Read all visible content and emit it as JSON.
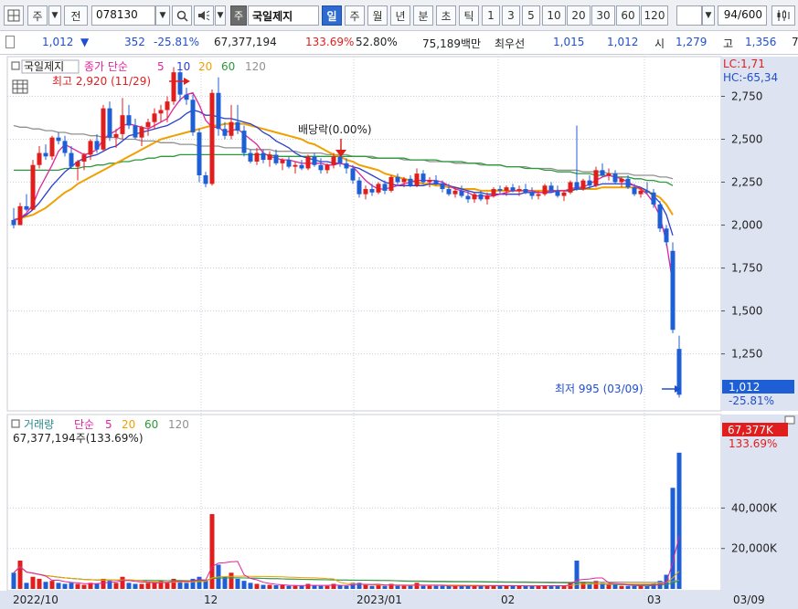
{
  "toolbar": {
    "market_type": "주",
    "code_prefix": "전",
    "stock_code": "078130",
    "stock_badge": "주",
    "stock_name": "국일제지",
    "periods": [
      "일",
      "주",
      "월",
      "년",
      "분",
      "초",
      "틱"
    ],
    "active_period": "일",
    "intervals": [
      "1",
      "3",
      "5",
      "10",
      "20",
      "30",
      "60",
      "120"
    ],
    "page_counter": "94",
    "page_total": "/600"
  },
  "quote": {
    "price": "1,012",
    "change_arrow": "▼",
    "change": "352",
    "change_pct": "-25.81%",
    "volume": "67,377,194",
    "volume_ratio": "133.69%",
    "turnover_ratio": "52.80%",
    "trade_value": "75,189백만",
    "best_label": "최우선",
    "best_ask": "1,015",
    "best_bid": "1,012",
    "open_label": "시",
    "open": "1,279",
    "high_label": "고",
    "high": "1,356",
    "trailing": "7"
  },
  "price_panel": {
    "title": "국일제지",
    "ma_label": "종가 단순",
    "ma_periods": [
      "5",
      "10",
      "20",
      "60",
      "120"
    ],
    "ma_colors": {
      "5": "#e0249a",
      "10": "#2a3fd0",
      "20": "#f0a000",
      "60": "#2a9a3a",
      "120": "#909090"
    },
    "lc": "LC:1,71",
    "hc": "HC:-65,34",
    "high_marker": "최고 2,920 (11/29)",
    "low_marker": "최저 995 (03/09)",
    "dividend_marker": "배당락(0.00%)",
    "last_price": "1,012",
    "last_change_pct": "-25.81%",
    "y_ticks": [
      "2,750",
      "2,500",
      "2,250",
      "2,000",
      "1,750",
      "1,500",
      "1,250"
    ]
  },
  "volume_panel": {
    "title": "거래량",
    "ma_label": "단순",
    "ma_periods": [
      "5",
      "20",
      "60",
      "120"
    ],
    "info": "67,377,194주(133.69%)",
    "last_volume": "67,377K",
    "last_ratio": "133.69%",
    "y_ticks": [
      "40,000K",
      "20,000K"
    ]
  },
  "x_axis": {
    "labels": [
      "2022/10",
      "12",
      "2023/01",
      "02",
      "03",
      "03/09"
    ]
  },
  "colors": {
    "up": "#e01e1e",
    "down": "#1f5fd6",
    "axis_bg": "#dde3f0",
    "accent": "#2d6bd0"
  },
  "chart_data": {
    "type": "candlestick",
    "price_range": [
      950,
      2960
    ],
    "volume_range": [
      0,
      70000
    ],
    "candles": [
      [
        2030,
        2100,
        1980,
        2000,
        8000
      ],
      [
        2000,
        2130,
        2000,
        2110,
        14000
      ],
      [
        2110,
        2180,
        2080,
        2090,
        3000
      ],
      [
        2090,
        2380,
        2090,
        2350,
        6000
      ],
      [
        2350,
        2460,
        2330,
        2420,
        5000
      ],
      [
        2420,
        2470,
        2380,
        2400,
        3500
      ],
      [
        2400,
        2520,
        2380,
        2510,
        4000
      ],
      [
        2510,
        2540,
        2470,
        2490,
        3000
      ],
      [
        2490,
        2520,
        2400,
        2420,
        2500
      ],
      [
        2420,
        2460,
        2330,
        2340,
        3000
      ],
      [
        2340,
        2380,
        2260,
        2370,
        2500
      ],
      [
        2370,
        2420,
        2320,
        2410,
        2000
      ],
      [
        2410,
        2500,
        2380,
        2490,
        3000
      ],
      [
        2490,
        2530,
        2420,
        2440,
        2500
      ],
      [
        2440,
        2700,
        2430,
        2680,
        5000
      ],
      [
        2680,
        2720,
        2490,
        2510,
        4000
      ],
      [
        2510,
        2560,
        2450,
        2530,
        3000
      ],
      [
        2530,
        2740,
        2500,
        2640,
        6000
      ],
      [
        2640,
        2700,
        2560,
        2580,
        3000
      ],
      [
        2580,
        2620,
        2500,
        2510,
        2500
      ],
      [
        2510,
        2580,
        2460,
        2570,
        2500
      ],
      [
        2570,
        2620,
        2520,
        2600,
        3000
      ],
      [
        2600,
        2680,
        2560,
        2650,
        3500
      ],
      [
        2650,
        2700,
        2600,
        2670,
        4000
      ],
      [
        2670,
        2750,
        2600,
        2720,
        3000
      ],
      [
        2720,
        2920,
        2700,
        2890,
        5000
      ],
      [
        2890,
        2900,
        2720,
        2760,
        4000
      ],
      [
        2760,
        2800,
        2700,
        2730,
        3000
      ],
      [
        2730,
        2760,
        2520,
        2540,
        5000
      ],
      [
        2540,
        2560,
        2250,
        2290,
        6000
      ],
      [
        2290,
        2310,
        2220,
        2240,
        4000
      ],
      [
        2240,
        2790,
        2230,
        2770,
        37000
      ],
      [
        2770,
        2860,
        2520,
        2560,
        12000
      ],
      [
        2560,
        2600,
        2500,
        2520,
        6000
      ],
      [
        2520,
        2700,
        2500,
        2600,
        8000
      ],
      [
        2600,
        2700,
        2530,
        2550,
        5000
      ],
      [
        2550,
        2580,
        2400,
        2420,
        4000
      ],
      [
        2420,
        2440,
        2360,
        2370,
        3000
      ],
      [
        2370,
        2450,
        2350,
        2420,
        2500
      ],
      [
        2420,
        2440,
        2360,
        2380,
        2000
      ],
      [
        2380,
        2430,
        2340,
        2410,
        2000
      ],
      [
        2410,
        2440,
        2350,
        2360,
        1800
      ],
      [
        2360,
        2390,
        2320,
        2380,
        1800
      ],
      [
        2380,
        2400,
        2330,
        2340,
        1500
      ],
      [
        2340,
        2370,
        2300,
        2350,
        1500
      ],
      [
        2350,
        2380,
        2320,
        2330,
        1500
      ],
      [
        2330,
        2410,
        2320,
        2400,
        2500
      ],
      [
        2400,
        2420,
        2340,
        2350,
        1800
      ],
      [
        2350,
        2390,
        2300,
        2320,
        1500
      ],
      [
        2320,
        2360,
        2300,
        2350,
        1500
      ],
      [
        2350,
        2420,
        2330,
        2400,
        2500
      ],
      [
        2400,
        2410,
        2340,
        2360,
        1800
      ],
      [
        2360,
        2390,
        2300,
        2330,
        1500
      ],
      [
        2330,
        2350,
        2240,
        2260,
        3000
      ],
      [
        2260,
        2280,
        2160,
        2180,
        3000
      ],
      [
        2180,
        2230,
        2150,
        2210,
        2000
      ],
      [
        2210,
        2240,
        2170,
        2190,
        1500
      ],
      [
        2190,
        2250,
        2180,
        2240,
        2000
      ],
      [
        2240,
        2260,
        2180,
        2200,
        1500
      ],
      [
        2200,
        2290,
        2190,
        2280,
        2500
      ],
      [
        2280,
        2300,
        2230,
        2250,
        1500
      ],
      [
        2250,
        2280,
        2220,
        2270,
        1500
      ],
      [
        2270,
        2290,
        2220,
        2230,
        1500
      ],
      [
        2230,
        2330,
        2220,
        2300,
        3000
      ],
      [
        2300,
        2320,
        2240,
        2250,
        1500
      ],
      [
        2250,
        2280,
        2220,
        2260,
        1500
      ],
      [
        2260,
        2290,
        2230,
        2240,
        1500
      ],
      [
        2240,
        2260,
        2190,
        2210,
        1500
      ],
      [
        2210,
        2240,
        2170,
        2180,
        1500
      ],
      [
        2180,
        2220,
        2160,
        2200,
        1500
      ],
      [
        2200,
        2230,
        2160,
        2170,
        1500
      ],
      [
        2170,
        2200,
        2130,
        2150,
        1500
      ],
      [
        2150,
        2190,
        2130,
        2180,
        1500
      ],
      [
        2180,
        2200,
        2140,
        2150,
        1500
      ],
      [
        2150,
        2190,
        2120,
        2170,
        1500
      ],
      [
        2170,
        2220,
        2160,
        2210,
        1800
      ],
      [
        2210,
        2230,
        2180,
        2200,
        1500
      ],
      [
        2200,
        2230,
        2170,
        2220,
        1500
      ],
      [
        2220,
        2240,
        2190,
        2200,
        1500
      ],
      [
        2200,
        2230,
        2170,
        2210,
        1500
      ],
      [
        2210,
        2240,
        2180,
        2190,
        1500
      ],
      [
        2190,
        2220,
        2150,
        2170,
        1500
      ],
      [
        2170,
        2200,
        2150,
        2180,
        1500
      ],
      [
        2180,
        2240,
        2170,
        2230,
        1800
      ],
      [
        2230,
        2250,
        2190,
        2200,
        1500
      ],
      [
        2200,
        2230,
        2160,
        2170,
        1500
      ],
      [
        2170,
        2200,
        2140,
        2190,
        1500
      ],
      [
        2190,
        2260,
        2180,
        2250,
        3000
      ],
      [
        2250,
        2580,
        2200,
        2210,
        14000
      ],
      [
        2210,
        2270,
        2200,
        2260,
        3500
      ],
      [
        2260,
        2290,
        2210,
        2230,
        2500
      ],
      [
        2230,
        2340,
        2220,
        2320,
        4000
      ],
      [
        2320,
        2360,
        2280,
        2290,
        3000
      ],
      [
        2290,
        2330,
        2260,
        2300,
        2000
      ],
      [
        2300,
        2320,
        2240,
        2250,
        2000
      ],
      [
        2250,
        2280,
        2220,
        2270,
        1500
      ],
      [
        2270,
        2290,
        2210,
        2220,
        1500
      ],
      [
        2220,
        2240,
        2170,
        2180,
        1500
      ],
      [
        2180,
        2220,
        2160,
        2200,
        1500
      ],
      [
        2200,
        2250,
        2180,
        2190,
        1500
      ],
      [
        2190,
        2210,
        2100,
        2120,
        2500
      ],
      [
        2120,
        2140,
        1960,
        1980,
        4000
      ],
      [
        1980,
        2000,
        1880,
        1900,
        7000
      ],
      [
        1850,
        1900,
        1370,
        1390,
        50000
      ],
      [
        1279,
        1356,
        995,
        1012,
        67377
      ]
    ],
    "ma": {
      "5": [
        2030,
        2040,
        2070,
        2120,
        2210,
        2280,
        2350,
        2430,
        2470,
        2450,
        2430,
        2410,
        2420,
        2440,
        2500,
        2530,
        2550,
        2580,
        2590,
        2580,
        2570,
        2560,
        2580,
        2600,
        2620,
        2680,
        2730,
        2760,
        2770,
        2700,
        2610,
        2570,
        2570,
        2540,
        2550,
        2560,
        2530,
        2500,
        2470,
        2420,
        2400,
        2390,
        2380,
        2380,
        2370,
        2360,
        2360,
        2360,
        2360,
        2350,
        2350,
        2360,
        2350,
        2340,
        2300,
        2260,
        2230,
        2210,
        2210,
        2220,
        2230,
        2240,
        2250,
        2260,
        2260,
        2260,
        2260,
        2250,
        2230,
        2210,
        2200,
        2190,
        2170,
        2170,
        2170,
        2170,
        2180,
        2190,
        2200,
        2200,
        2200,
        2200,
        2190,
        2190,
        2200,
        2200,
        2200,
        2210,
        2220,
        2220,
        2240,
        2260,
        2280,
        2290,
        2280,
        2270,
        2250,
        2230,
        2210,
        2180,
        2130,
        2050,
        1900,
        1660
      ],
      "10": [
        2030,
        2040,
        2060,
        2090,
        2130,
        2180,
        2230,
        2270,
        2310,
        2340,
        2370,
        2390,
        2400,
        2410,
        2430,
        2450,
        2460,
        2490,
        2520,
        2530,
        2540,
        2550,
        2560,
        2570,
        2580,
        2600,
        2620,
        2650,
        2670,
        2660,
        2640,
        2640,
        2630,
        2620,
        2620,
        2610,
        2600,
        2590,
        2570,
        2540,
        2520,
        2490,
        2470,
        2450,
        2420,
        2400,
        2390,
        2380,
        2370,
        2370,
        2360,
        2360,
        2350,
        2340,
        2330,
        2310,
        2290,
        2270,
        2250,
        2240,
        2230,
        2230,
        2230,
        2230,
        2230,
        2240,
        2240,
        2240,
        2230,
        2220,
        2210,
        2200,
        2190,
        2190,
        2180,
        2180,
        2180,
        2180,
        2180,
        2180,
        2190,
        2190,
        2190,
        2190,
        2190,
        2200,
        2200,
        2200,
        2210,
        2210,
        2220,
        2230,
        2240,
        2240,
        2240,
        2240,
        2240,
        2230,
        2220,
        2200,
        2170,
        2130,
        2060,
        1940
      ],
      "20": [
        2030,
        2040,
        2050,
        2060,
        2080,
        2100,
        2130,
        2160,
        2190,
        2210,
        2240,
        2260,
        2280,
        2300,
        2320,
        2340,
        2360,
        2380,
        2400,
        2420,
        2440,
        2460,
        2480,
        2500,
        2510,
        2520,
        2530,
        2540,
        2550,
        2560,
        2570,
        2580,
        2580,
        2590,
        2590,
        2590,
        2590,
        2580,
        2570,
        2560,
        2550,
        2540,
        2530,
        2520,
        2510,
        2500,
        2480,
        2470,
        2450,
        2430,
        2410,
        2400,
        2380,
        2370,
        2350,
        2340,
        2330,
        2320,
        2300,
        2290,
        2280,
        2270,
        2260,
        2250,
        2240,
        2240,
        2230,
        2230,
        2220,
        2220,
        2210,
        2210,
        2210,
        2200,
        2200,
        2200,
        2200,
        2200,
        2200,
        2200,
        2200,
        2200,
        2200,
        2200,
        2200,
        2200,
        2200,
        2200,
        2210,
        2210,
        2210,
        2210,
        2220,
        2220,
        2220,
        2220,
        2220,
        2220,
        2210,
        2200,
        2180,
        2160,
        2120,
        2060
      ],
      "60": [
        2320,
        2320,
        2320,
        2320,
        2320,
        2320,
        2320,
        2320,
        2330,
        2330,
        2330,
        2340,
        2340,
        2350,
        2350,
        2360,
        2360,
        2370,
        2370,
        2380,
        2380,
        2390,
        2390,
        2400,
        2400,
        2400,
        2410,
        2410,
        2410,
        2410,
        2410,
        2410,
        2410,
        2410,
        2410,
        2410,
        2410,
        2410,
        2410,
        2410,
        2410,
        2400,
        2400,
        2400,
        2400,
        2400,
        2400,
        2400,
        2400,
        2400,
        2400,
        2400,
        2400,
        2400,
        2400,
        2400,
        2390,
        2390,
        2390,
        2390,
        2390,
        2390,
        2380,
        2380,
        2380,
        2380,
        2380,
        2370,
        2370,
        2370,
        2370,
        2360,
        2360,
        2360,
        2350,
        2350,
        2350,
        2340,
        2340,
        2340,
        2330,
        2330,
        2330,
        2320,
        2320,
        2310,
        2310,
        2310,
        2300,
        2300,
        2300,
        2290,
        2290,
        2290,
        2280,
        2280,
        2280,
        2270,
        2270,
        2260,
        2260,
        2250,
        2250,
        2230
      ],
      "120": [
        2580,
        2570,
        2570,
        2560,
        2560,
        2550,
        2550,
        2540,
        2540,
        2530,
        2530,
        2530,
        2520,
        2520,
        2510,
        2510,
        2510,
        2500,
        2500,
        2500,
        2490,
        2490,
        2490,
        2480,
        2480,
        2480,
        2470,
        2470,
        2470,
        2460,
        2460,
        2460,
        2460,
        2450,
        2450,
        2450,
        2450,
        2440,
        2440,
        2440,
        2440,
        2430,
        2430,
        2430,
        2430,
        2420,
        2420,
        2420,
        2420,
        2410,
        2410,
        2410,
        2410,
        2400,
        2400,
        2400,
        2400,
        2390,
        2390,
        2390,
        2390,
        2380,
        2380,
        2380,
        2380,
        2370,
        2370,
        2370,
        2370,
        2360,
        2360,
        2360,
        2360,
        2350,
        2350,
        2350,
        2350,
        2340,
        2340,
        2340,
        2340,
        2330,
        2330,
        2330,
        2330,
        2320,
        2320,
        2320,
        2320,
        2310,
        2310,
        2310,
        2310,
        2300,
        2300,
        2300,
        2300,
        2290,
        2290,
        2290,
        2290,
        2280,
        2280,
        2270
      ]
    }
  }
}
